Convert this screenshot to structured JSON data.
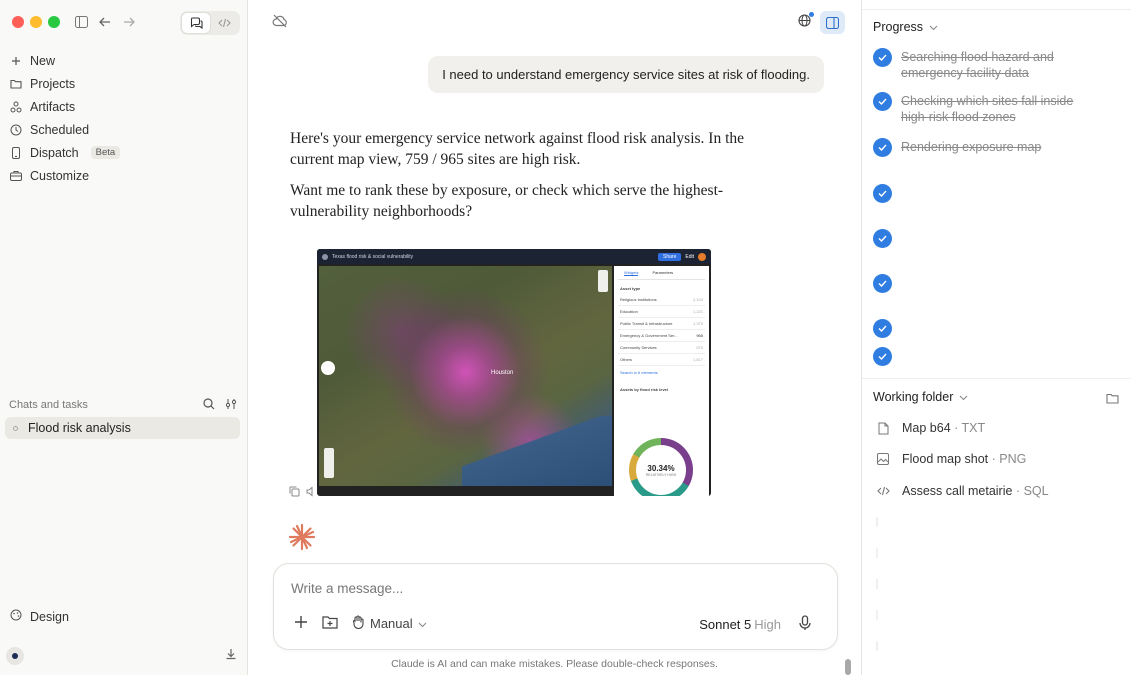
{
  "sidebar": {
    "nav": [
      {
        "label": "New",
        "icon": "plus-icon"
      },
      {
        "label": "Projects",
        "icon": "folder-icon"
      },
      {
        "label": "Artifacts",
        "icon": "artifacts-icon"
      },
      {
        "label": "Scheduled",
        "icon": "clock-icon"
      },
      {
        "label": "Dispatch",
        "icon": "phone-icon",
        "badge": "Beta"
      },
      {
        "label": "Customize",
        "icon": "briefcase-icon"
      }
    ],
    "section_label": "Chats and tasks",
    "chats": [
      {
        "label": "Flood risk analysis"
      }
    ],
    "design_label": "Design"
  },
  "main": {
    "user_message": "I need to understand emergency service sites at risk of flooding.",
    "reply": {
      "p1": "Here's your emergency service network against flood risk analysis. In the current map view, 759 / 965 sites are high risk.",
      "p2": "Want me to rank these by exposure, or check which serve the highest-vulnerability neighborhoods?"
    },
    "screenshot": {
      "title": "Texas flood risk & social vulnerability",
      "share": "Share",
      "edit": "Edit",
      "tabs": [
        "Widgets",
        "Parameters"
      ],
      "section": "Asset type",
      "rows": [
        {
          "label": "Religious Institutions",
          "n": "2,104"
        },
        {
          "label": "Education",
          "n": "1,221"
        },
        {
          "label": "Public Transit & Infrastructure",
          "n": "1,379"
        },
        {
          "label": "Emergency & Government Ser...",
          "n": "965"
        },
        {
          "label": "Community Services",
          "n": "570"
        },
        {
          "label": "Others",
          "n": "1,817"
        }
      ],
      "link": "Search in 6 elements",
      "chart_title": "Assets by flood risk level",
      "donut_pct": "30.34%",
      "donut_sub": "RELATIVELY HIGH",
      "city": "Houston"
    },
    "composer": {
      "placeholder": "Write a message...",
      "mode": "Manual",
      "model": "Sonnet 5",
      "effort": "High"
    },
    "disclaimer": "Claude is AI and can make mistakes. Please double-check responses."
  },
  "right": {
    "progress_title": "Progress",
    "steps": [
      "Searching flood hazard and emergency facility data",
      "Checking which sites fall inside high-risk flood zones",
      "Rendering exposure map",
      "",
      "",
      "",
      "",
      ""
    ],
    "folder_title": "Working folder",
    "files": [
      {
        "name": "Map b64",
        "ext": "TXT",
        "icon": "document-icon"
      },
      {
        "name": "Flood map shot",
        "ext": "PNG",
        "icon": "image-icon"
      },
      {
        "name": "Assess call metairie",
        "ext": "SQL",
        "icon": "code-icon"
      }
    ]
  },
  "colors": {
    "accent": "#2f7de1",
    "spark": "#e07a5f"
  }
}
